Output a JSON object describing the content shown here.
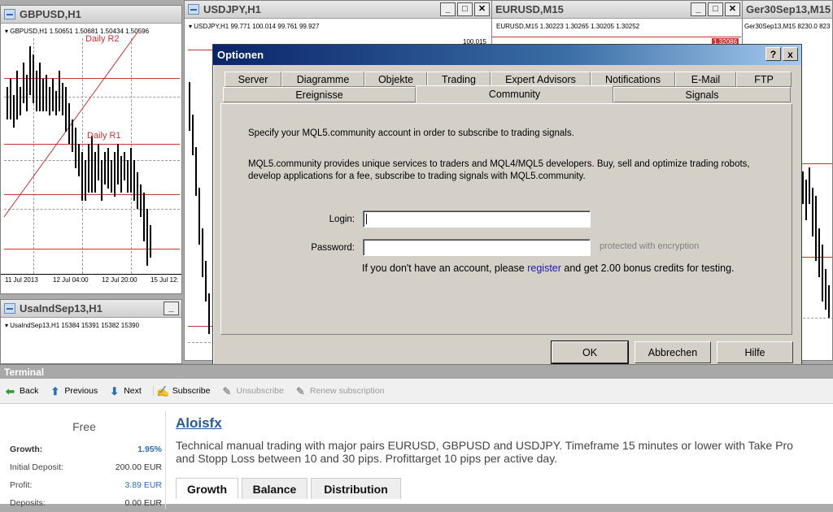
{
  "windows": {
    "gbpusd": {
      "title": "GBPUSD,H1",
      "header": "GBPUSD,H1  1.50651 1.50681 1.50434 1.50596",
      "daily_r2": "Daily R2",
      "daily_r1": "Daily R1",
      "x_labels": [
        "11 Jul 2013",
        "12 Jul 04:00",
        "12 Jul 20:00",
        "15 Jul 12:"
      ]
    },
    "usdjpy": {
      "title": "USDJPY,H1",
      "header": "USDJPY,H1  99.771 100.014 99.761 99.927",
      "price_tag": "100.015"
    },
    "eurusd": {
      "title": "EURUSD,M15",
      "header": "EURUSD,M15  1.30223 1.30265 1.30205 1.30252",
      "price_tag": "1.32086"
    },
    "ger30": {
      "title": "Ger30Sep13,M15",
      "header": "Ger30Sep13,M15  8230.0 823"
    },
    "usaind": {
      "title": "UsaIndSep13,H1",
      "header": "UsaIndSep13,H1  15384 15391 15382 15390"
    }
  },
  "dialog": {
    "title": "Optionen",
    "help_btn": "?",
    "close_btn": "x",
    "tabs_row1": [
      "Server",
      "Diagramme",
      "Objekte",
      "Trading",
      "Expert Advisors",
      "Notifications",
      "E-Mail",
      "FTP"
    ],
    "tabs_row2": [
      "Ereignisse",
      "Community",
      "Signals"
    ],
    "selected_tab": "Community",
    "intro": "Specify your MQL5.community account in order to subscribe to trading signals.",
    "description": "MQL5.community provides unique services to traders and MQL4/MQL5 developers. Buy, sell and optimize trading robots, develop applications for a fee, subscribe to trading signals with MQL5.community.",
    "login_label": "Login:",
    "login_value": "",
    "password_label": "Password:",
    "password_value": "",
    "password_hint": "protected with encryption",
    "account_text_before": "If you don't have an account, please ",
    "register_link": "register",
    "account_text_after": " and get 2.00 bonus credits for testing.",
    "ok": "OK",
    "cancel": "Abbrechen",
    "help": "Hilfe"
  },
  "terminal": {
    "title": "Terminal",
    "toolbar": {
      "back": "Back",
      "previous": "Previous",
      "next": "Next",
      "subscribe": "Subscribe",
      "unsubscribe": "Unsubscribe",
      "renew": "Renew subscription"
    },
    "plan": "Free",
    "stats": [
      {
        "label": "Growth:",
        "value": "1.95%"
      },
      {
        "label": "Initial Deposit:",
        "value": "200.00 EUR"
      },
      {
        "label": "Profit:",
        "value": "3.89 EUR"
      },
      {
        "label": "Deposits:",
        "value": "0.00 EUR"
      }
    ],
    "signal_name": "Aloisfx",
    "signal_desc": "Technical manual trading with major pairs EURUSD, GBPUSD and USDJPY. Timeframe 15 minutes or lower with Take Pro\nand Stopp Loss between 10 and 30 pips. Profittarget 10 pips per active day.",
    "tabs": [
      "Growth",
      "Balance",
      "Distribution"
    ]
  },
  "colors": {
    "dialog_title": "#0a246a",
    "link": "#1a1aa8",
    "resistance": "#cc3333",
    "signal_name": "#2a5a99"
  }
}
